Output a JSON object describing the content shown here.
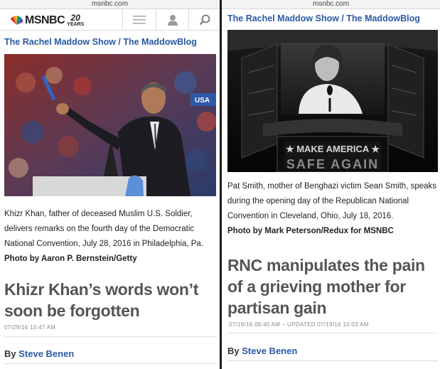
{
  "left": {
    "url": "msnbc.com",
    "logo": {
      "text": "MSNBC",
      "badge_number": "20",
      "badge_word": "YEARS"
    },
    "nav": {
      "menu_icon": "menu-icon",
      "profile_icon": "profile-icon",
      "search_icon": "search-icon"
    },
    "breadcrumb": "The Rachel Maddow Show / The MaddowBlog",
    "photo": {
      "subject": "Khizr Khan at podium"
    },
    "caption": "Khizr Khan, father of deceased Muslim U.S. Soldier, delivers remarks on the fourth day of the Democratic National Convention, July 28, 2016 in Philadelphia, Pa.",
    "credit": "Photo by Aaron P. Bernstein/Getty",
    "headline": "Khizr Khan’s words won’t soon be forgotten",
    "timestamp": "07/29/16 10:47 AM",
    "byline_prefix": "By",
    "author": "Steve Benen"
  },
  "right": {
    "url": "msnbc.com",
    "breadcrumb": "The Rachel Maddow Show / The MaddowBlog",
    "photo": {
      "subject": "Pat Smith on stage",
      "sign_line1": "★ MAKE AMERICA ★",
      "sign_line2": "SAFE AGAIN"
    },
    "caption": "Pat Smith, mother of Benghazi victim Sean Smith, speaks during the opening day of the Republican National Convention in Cleveland, Ohio, July 18, 2016.",
    "credit": "Photo by Mark Peterson/Redux for MSNBC",
    "headline": "RNC manipulates the pain of a grieving mother for partisan gain",
    "timestamp": "07/19/16 08:40 AM – UPDATED 07/19/16 10:03 AM",
    "byline_prefix": "By",
    "author": "Steve Benen"
  },
  "colors": {
    "link": "#2a5aa5",
    "headline": "#555555",
    "timestamp": "#888888"
  }
}
